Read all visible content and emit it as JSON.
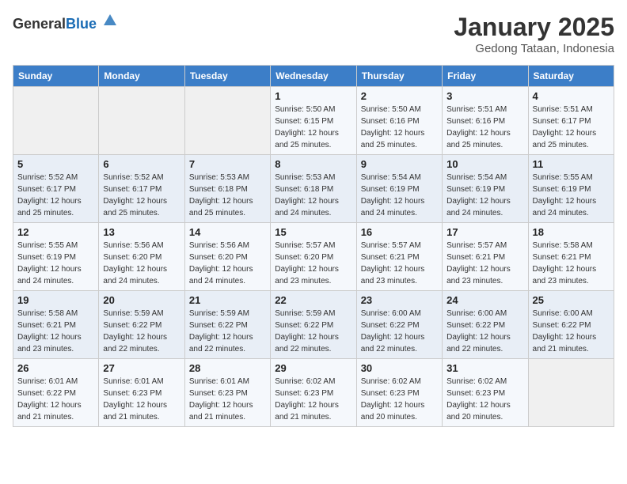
{
  "header": {
    "logo_general": "General",
    "logo_blue": "Blue",
    "month_title": "January 2025",
    "subtitle": "Gedong Tataan, Indonesia"
  },
  "calendar": {
    "weekdays": [
      "Sunday",
      "Monday",
      "Tuesday",
      "Wednesday",
      "Thursday",
      "Friday",
      "Saturday"
    ],
    "rows": [
      [
        {
          "day": "",
          "info": ""
        },
        {
          "day": "",
          "info": ""
        },
        {
          "day": "",
          "info": ""
        },
        {
          "day": "1",
          "info": "Sunrise: 5:50 AM\nSunset: 6:15 PM\nDaylight: 12 hours\nand 25 minutes."
        },
        {
          "day": "2",
          "info": "Sunrise: 5:50 AM\nSunset: 6:16 PM\nDaylight: 12 hours\nand 25 minutes."
        },
        {
          "day": "3",
          "info": "Sunrise: 5:51 AM\nSunset: 6:16 PM\nDaylight: 12 hours\nand 25 minutes."
        },
        {
          "day": "4",
          "info": "Sunrise: 5:51 AM\nSunset: 6:17 PM\nDaylight: 12 hours\nand 25 minutes."
        }
      ],
      [
        {
          "day": "5",
          "info": "Sunrise: 5:52 AM\nSunset: 6:17 PM\nDaylight: 12 hours\nand 25 minutes."
        },
        {
          "day": "6",
          "info": "Sunrise: 5:52 AM\nSunset: 6:17 PM\nDaylight: 12 hours\nand 25 minutes."
        },
        {
          "day": "7",
          "info": "Sunrise: 5:53 AM\nSunset: 6:18 PM\nDaylight: 12 hours\nand 25 minutes."
        },
        {
          "day": "8",
          "info": "Sunrise: 5:53 AM\nSunset: 6:18 PM\nDaylight: 12 hours\nand 24 minutes."
        },
        {
          "day": "9",
          "info": "Sunrise: 5:54 AM\nSunset: 6:19 PM\nDaylight: 12 hours\nand 24 minutes."
        },
        {
          "day": "10",
          "info": "Sunrise: 5:54 AM\nSunset: 6:19 PM\nDaylight: 12 hours\nand 24 minutes."
        },
        {
          "day": "11",
          "info": "Sunrise: 5:55 AM\nSunset: 6:19 PM\nDaylight: 12 hours\nand 24 minutes."
        }
      ],
      [
        {
          "day": "12",
          "info": "Sunrise: 5:55 AM\nSunset: 6:19 PM\nDaylight: 12 hours\nand 24 minutes."
        },
        {
          "day": "13",
          "info": "Sunrise: 5:56 AM\nSunset: 6:20 PM\nDaylight: 12 hours\nand 24 minutes."
        },
        {
          "day": "14",
          "info": "Sunrise: 5:56 AM\nSunset: 6:20 PM\nDaylight: 12 hours\nand 24 minutes."
        },
        {
          "day": "15",
          "info": "Sunrise: 5:57 AM\nSunset: 6:20 PM\nDaylight: 12 hours\nand 23 minutes."
        },
        {
          "day": "16",
          "info": "Sunrise: 5:57 AM\nSunset: 6:21 PM\nDaylight: 12 hours\nand 23 minutes."
        },
        {
          "day": "17",
          "info": "Sunrise: 5:57 AM\nSunset: 6:21 PM\nDaylight: 12 hours\nand 23 minutes."
        },
        {
          "day": "18",
          "info": "Sunrise: 5:58 AM\nSunset: 6:21 PM\nDaylight: 12 hours\nand 23 minutes."
        }
      ],
      [
        {
          "day": "19",
          "info": "Sunrise: 5:58 AM\nSunset: 6:21 PM\nDaylight: 12 hours\nand 23 minutes."
        },
        {
          "day": "20",
          "info": "Sunrise: 5:59 AM\nSunset: 6:22 PM\nDaylight: 12 hours\nand 22 minutes."
        },
        {
          "day": "21",
          "info": "Sunrise: 5:59 AM\nSunset: 6:22 PM\nDaylight: 12 hours\nand 22 minutes."
        },
        {
          "day": "22",
          "info": "Sunrise: 5:59 AM\nSunset: 6:22 PM\nDaylight: 12 hours\nand 22 minutes."
        },
        {
          "day": "23",
          "info": "Sunrise: 6:00 AM\nSunset: 6:22 PM\nDaylight: 12 hours\nand 22 minutes."
        },
        {
          "day": "24",
          "info": "Sunrise: 6:00 AM\nSunset: 6:22 PM\nDaylight: 12 hours\nand 22 minutes."
        },
        {
          "day": "25",
          "info": "Sunrise: 6:00 AM\nSunset: 6:22 PM\nDaylight: 12 hours\nand 21 minutes."
        }
      ],
      [
        {
          "day": "26",
          "info": "Sunrise: 6:01 AM\nSunset: 6:22 PM\nDaylight: 12 hours\nand 21 minutes."
        },
        {
          "day": "27",
          "info": "Sunrise: 6:01 AM\nSunset: 6:23 PM\nDaylight: 12 hours\nand 21 minutes."
        },
        {
          "day": "28",
          "info": "Sunrise: 6:01 AM\nSunset: 6:23 PM\nDaylight: 12 hours\nand 21 minutes."
        },
        {
          "day": "29",
          "info": "Sunrise: 6:02 AM\nSunset: 6:23 PM\nDaylight: 12 hours\nand 21 minutes."
        },
        {
          "day": "30",
          "info": "Sunrise: 6:02 AM\nSunset: 6:23 PM\nDaylight: 12 hours\nand 20 minutes."
        },
        {
          "day": "31",
          "info": "Sunrise: 6:02 AM\nSunset: 6:23 PM\nDaylight: 12 hours\nand 20 minutes."
        },
        {
          "day": "",
          "info": ""
        }
      ]
    ]
  }
}
